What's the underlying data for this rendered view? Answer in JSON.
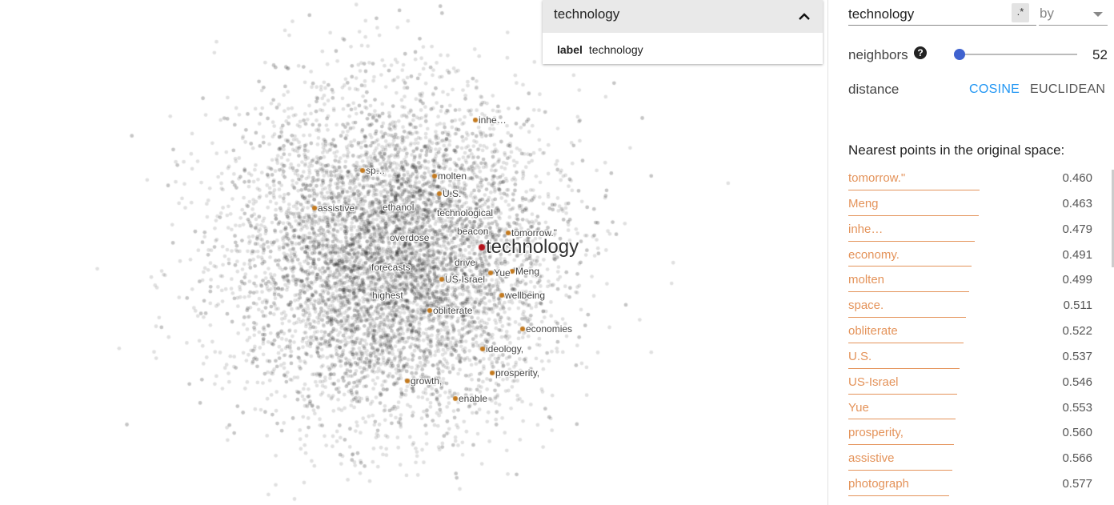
{
  "scatter": {
    "focus_label": "technology",
    "labels": [
      {
        "text": "inhe…",
        "hl": true
      },
      {
        "text": "sp…",
        "hl": true
      },
      {
        "text": "molten",
        "hl": true
      },
      {
        "text": "U.S.",
        "hl": true
      },
      {
        "text": "assistive",
        "hl": true
      },
      {
        "text": "ethanol",
        "hl": false
      },
      {
        "text": "technological",
        "hl": false
      },
      {
        "text": "beacon",
        "hl": false
      },
      {
        "text": "tomorrow.\"",
        "hl": true
      },
      {
        "text": "overdose",
        "hl": false
      },
      {
        "text": "drive",
        "hl": false
      },
      {
        "text": "forecasts",
        "hl": false
      },
      {
        "text": "Yue",
        "hl": true
      },
      {
        "text": "Meng",
        "hl": true
      },
      {
        "text": "US-Israel",
        "hl": true
      },
      {
        "text": "highest",
        "hl": false
      },
      {
        "text": "wellbeing",
        "hl": true
      },
      {
        "text": "obliterate",
        "hl": true
      },
      {
        "text": "economies",
        "hl": true
      },
      {
        "text": "ideology,",
        "hl": true
      },
      {
        "text": "prosperity,",
        "hl": true
      },
      {
        "text": "growth,",
        "hl": true
      },
      {
        "text": "enable",
        "hl": true
      }
    ]
  },
  "inspect": {
    "title": "technology",
    "field_key": "label",
    "field_value": "technology"
  },
  "search": {
    "value": "technology",
    "regex_label": ".*",
    "by_placeholder": "by"
  },
  "neighbors": {
    "label": "neighbors",
    "help": "?",
    "value": "52",
    "fraction": 0.0
  },
  "distance": {
    "label": "distance",
    "cosine": "COSINE",
    "euclidean": "EUCLIDEAN"
  },
  "nearest": {
    "title": "Nearest points in the original space:",
    "items": [
      {
        "label": "tomorrow.\"",
        "value": "0.460"
      },
      {
        "label": "Meng",
        "value": "0.463"
      },
      {
        "label": "inhe…",
        "value": "0.479"
      },
      {
        "label": "economy.",
        "value": "0.491"
      },
      {
        "label": "molten",
        "value": "0.499"
      },
      {
        "label": "space.",
        "value": "0.511"
      },
      {
        "label": "obliterate",
        "value": "0.522"
      },
      {
        "label": "U.S.",
        "value": "0.537"
      },
      {
        "label": "US-Israel",
        "value": "0.546"
      },
      {
        "label": "Yue",
        "value": "0.553"
      },
      {
        "label": "prosperity,",
        "value": "0.560"
      },
      {
        "label": "assistive",
        "value": "0.566"
      },
      {
        "label": "photograph",
        "value": "0.577"
      }
    ]
  },
  "colors": {
    "accent": "#2196f3",
    "neighbor": "#e4935a",
    "neighbor_dot": "#c47a1e",
    "point": "#000000"
  }
}
